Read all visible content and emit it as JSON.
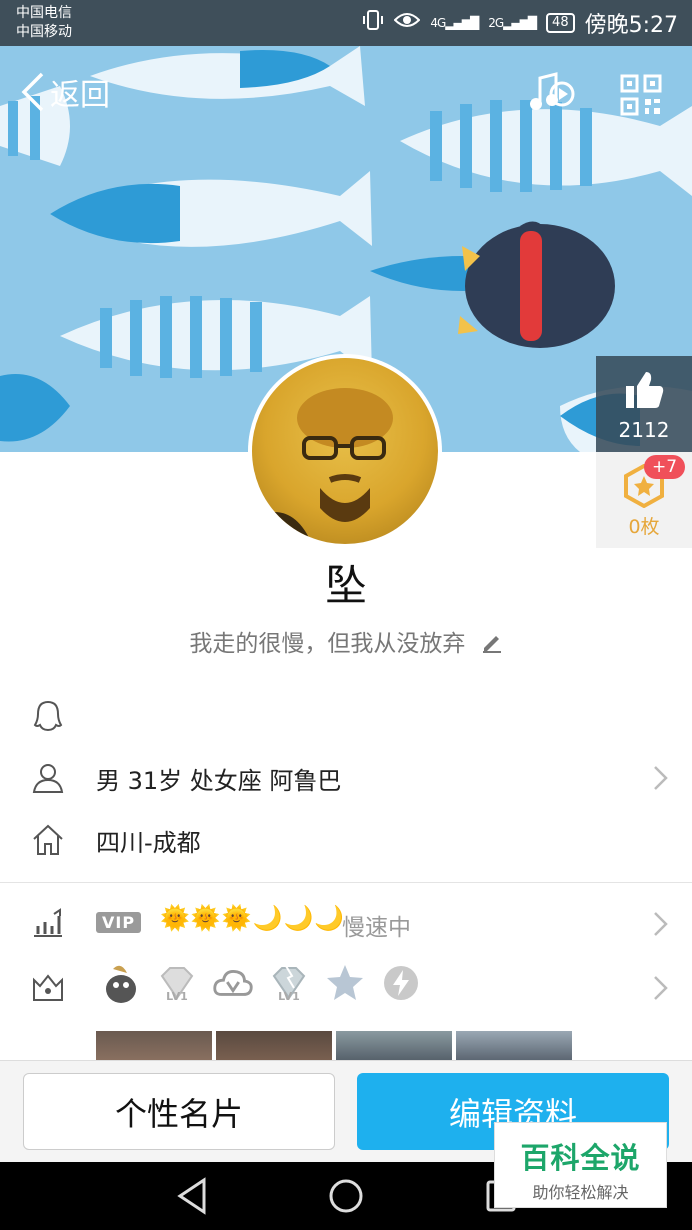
{
  "status_bar": {
    "carrier_1": "中国电信",
    "carrier_2": "中国移动",
    "network_1": "4G",
    "network_2": "2G",
    "battery": "48",
    "time": "傍晚5:27"
  },
  "top_bar": {
    "back_label": "返回"
  },
  "stats": {
    "likes": "2112",
    "coins": "0枚",
    "coin_badge": "+7"
  },
  "profile": {
    "nickname": "坠",
    "signature": "我走的很慢，但我从没放弃"
  },
  "info": {
    "basic": "男  31岁  处女座  阿鲁巴",
    "location": "四川-成都"
  },
  "level": {
    "vip_label": "VIP",
    "level_icons": "🌞🌞🌞🌙🌙🌙",
    "speed_text": "慢速中"
  },
  "services": {
    "items": [
      "qq-pet-icon",
      "diamond-lv1-icon",
      "cloud-v-icon",
      "diamond-lv1-icon",
      "star-icon",
      "lightning-icon"
    ],
    "lv_label": "LV1"
  },
  "buttons": {
    "card_label": "个性名片",
    "edit_label": "编辑资料"
  },
  "watermark": {
    "title": "百科全说",
    "subtitle": "助你轻松解决"
  },
  "colors": {
    "accent": "#1eb0ee",
    "banner_bg": "#8fc8e8",
    "coin": "#e6a73b",
    "badge": "#f0505a"
  }
}
